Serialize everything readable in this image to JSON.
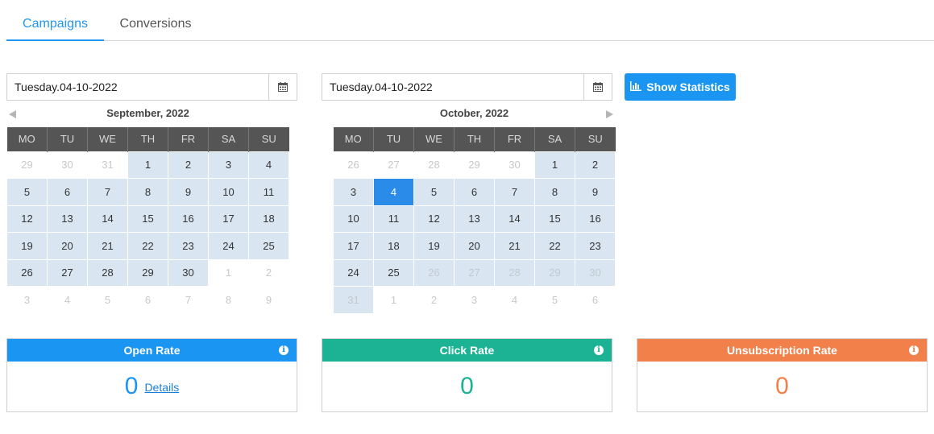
{
  "tabs": [
    {
      "label": "Campaigns",
      "active": true
    },
    {
      "label": "Conversions",
      "active": false
    }
  ],
  "date_from": {
    "value": "Tuesday.04-10-2022",
    "icon": "calendar-icon"
  },
  "date_to": {
    "value": "Tuesday.04-10-2022",
    "icon": "calendar-icon"
  },
  "show_statistics": {
    "label": "Show Statistics",
    "icon": "bar-chart-icon"
  },
  "weekdays": [
    "MO",
    "TU",
    "WE",
    "TH",
    "FR",
    "SA",
    "SU"
  ],
  "calendars": [
    {
      "title": "September, 2022",
      "weeks": [
        [
          "29",
          "30",
          "31",
          "1",
          "2",
          "3",
          "4"
        ],
        [
          "5",
          "6",
          "7",
          "8",
          "9",
          "10",
          "11"
        ],
        [
          "12",
          "13",
          "14",
          "15",
          "16",
          "17",
          "18"
        ],
        [
          "19",
          "20",
          "21",
          "22",
          "23",
          "24",
          "25"
        ],
        [
          "26",
          "27",
          "28",
          "29",
          "30",
          "1",
          "2"
        ],
        [
          "3",
          "4",
          "5",
          "6",
          "7",
          "8",
          "9"
        ]
      ],
      "styles": [
        [
          "out",
          "out",
          "out",
          "in",
          "in",
          "in",
          "in"
        ],
        [
          "in",
          "in",
          "in",
          "in",
          "in",
          "in",
          "in"
        ],
        [
          "in",
          "in",
          "in",
          "in",
          "in",
          "in",
          "in"
        ],
        [
          "in",
          "in",
          "in",
          "in",
          "in",
          "in",
          "in"
        ],
        [
          "in",
          "in",
          "in",
          "in",
          "in",
          "out",
          "out"
        ],
        [
          "out",
          "out",
          "out",
          "out",
          "out",
          "out",
          "out"
        ]
      ]
    },
    {
      "title": "October, 2022",
      "weeks": [
        [
          "26",
          "27",
          "28",
          "29",
          "30",
          "1",
          "2"
        ],
        [
          "3",
          "4",
          "5",
          "6",
          "7",
          "8",
          "9"
        ],
        [
          "10",
          "11",
          "12",
          "13",
          "14",
          "15",
          "16"
        ],
        [
          "17",
          "18",
          "19",
          "20",
          "21",
          "22",
          "23"
        ],
        [
          "24",
          "25",
          "26",
          "27",
          "28",
          "29",
          "30"
        ],
        [
          "31",
          "1",
          "2",
          "3",
          "4",
          "5",
          "6"
        ]
      ],
      "styles": [
        [
          "out",
          "out",
          "out",
          "out",
          "out",
          "in",
          "in"
        ],
        [
          "in",
          "sel",
          "in",
          "in",
          "in",
          "in",
          "in"
        ],
        [
          "in",
          "in",
          "in",
          "in",
          "in",
          "in",
          "in"
        ],
        [
          "in",
          "in",
          "in",
          "in",
          "in",
          "in",
          "in"
        ],
        [
          "in",
          "in",
          "in dim",
          "in dim",
          "in dim",
          "in dim",
          "in dim"
        ],
        [
          "in dim",
          "out",
          "out",
          "out",
          "out",
          "out",
          "out"
        ]
      ]
    }
  ],
  "cards": [
    {
      "title": "Open Rate",
      "value": "0",
      "link": "Details",
      "color": "#1a96f2"
    },
    {
      "title": "Click Rate",
      "value": "0",
      "color": "#1bb394"
    },
    {
      "title": "Unsubscription Rate",
      "value": "0",
      "color": "#f2804a"
    }
  ]
}
